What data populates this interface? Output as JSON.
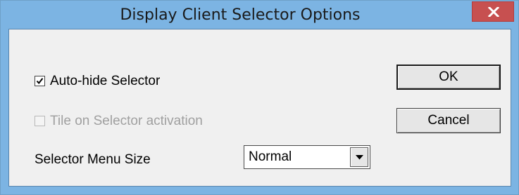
{
  "window": {
    "title": "Display Client Selector Options",
    "close_icon": "close-x-icon"
  },
  "options": {
    "auto_hide": {
      "label": "Auto-hide Selector",
      "checked": true,
      "enabled": true
    },
    "tile_on_activation": {
      "label": "Tile on Selector activation",
      "checked": false,
      "enabled": false
    }
  },
  "menu_size": {
    "label": "Selector Menu Size",
    "value": "Normal",
    "arrow_icon": "chevron-down-icon"
  },
  "buttons": {
    "ok": "OK",
    "cancel": "Cancel"
  },
  "colors": {
    "titlebar": "#7cb4e3",
    "close_button": "#c75050",
    "client_background": "#f0f0f0",
    "disabled_text": "#a0a0a0"
  }
}
